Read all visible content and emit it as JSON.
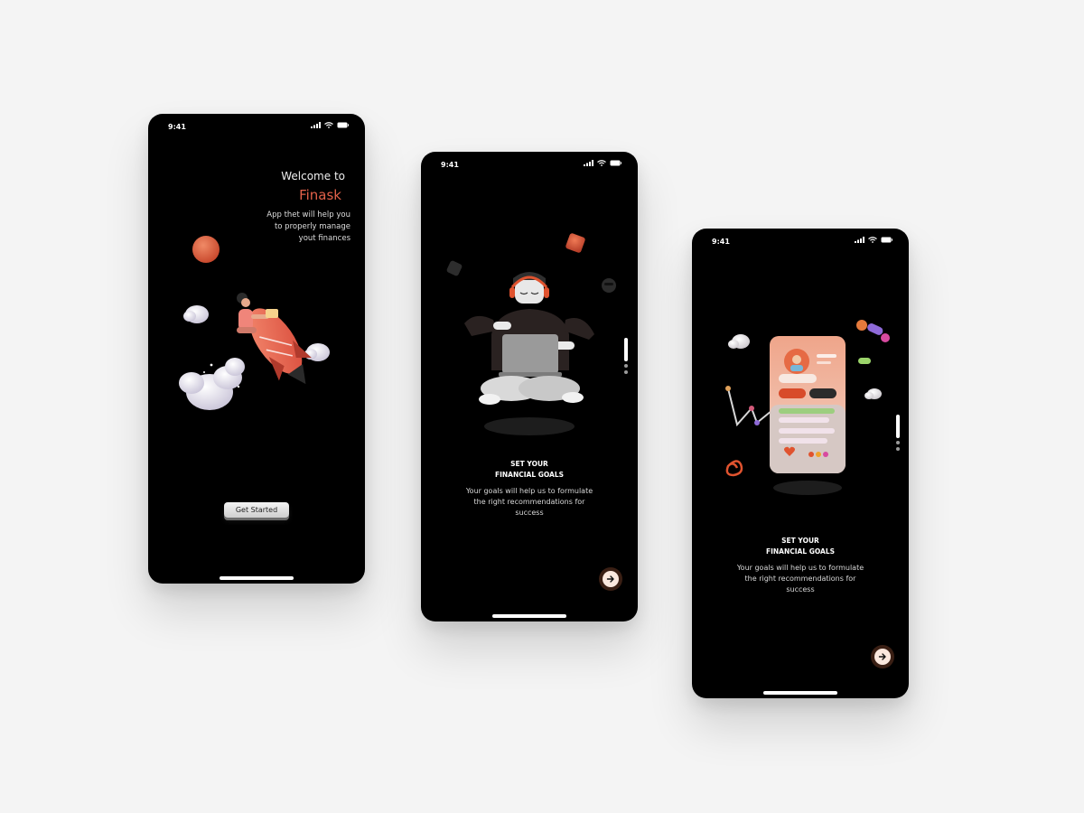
{
  "screens": [
    {
      "time": "9:41",
      "welcome_line": "Welcome to",
      "brand": "Finask",
      "description_lines": [
        "App thet will help you",
        "to properly manage",
        "yout finances"
      ],
      "cta_label": "Get Started"
    },
    {
      "time": "9:41",
      "title_lines": [
        "SET YOUR",
        "FINANCIAL GOALS"
      ],
      "description_lines": [
        "Your goals will help us to formulate",
        "the right recommendations for",
        "success"
      ],
      "next_icon": "arrow-right-icon",
      "pager": {
        "active": 1,
        "count": 3
      }
    },
    {
      "time": "9:41",
      "title_lines": [
        "SET YOUR",
        "FINANCIAL GOALS"
      ],
      "description_lines": [
        "Your goals will help us to formulate",
        "the right recommendations for",
        "success"
      ],
      "next_icon": "arrow-right-icon",
      "pager": {
        "active": 1,
        "count": 3
      }
    }
  ],
  "colors": {
    "brand_accent": "#e2614a",
    "screen_background": "#000000",
    "page_background": "#f4f4f4",
    "button_light": "#f3f3f3"
  }
}
